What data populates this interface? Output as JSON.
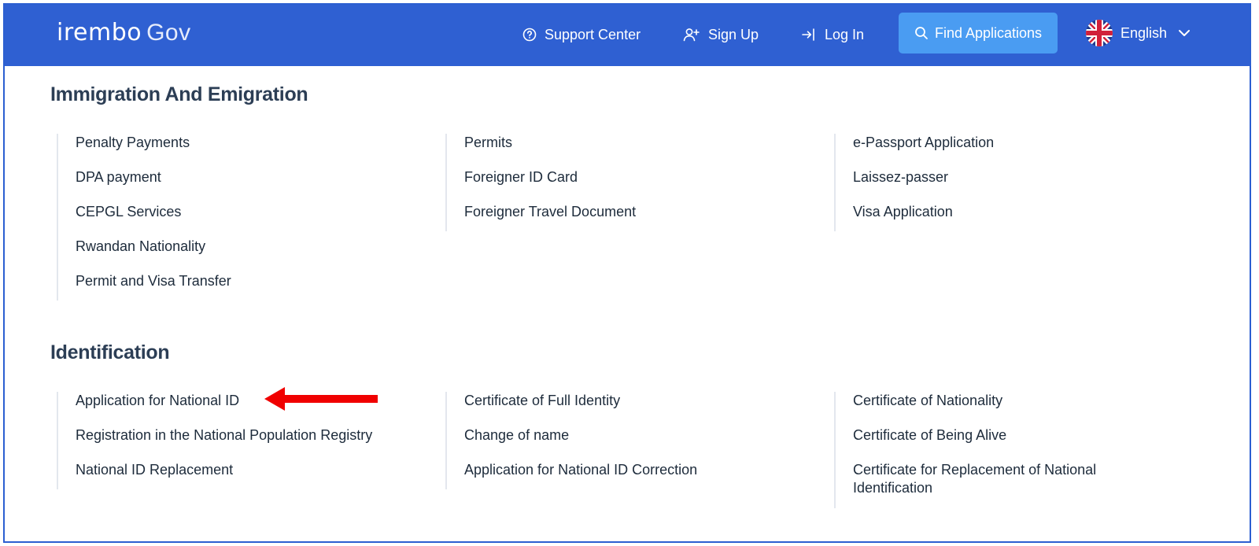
{
  "brand": {
    "name": "irembo",
    "suffix": "Gov"
  },
  "nav": {
    "support": "Support Center",
    "signup": "Sign Up",
    "login": "Log In",
    "find": "Find Applications",
    "language": "English"
  },
  "sections": [
    {
      "title": "Immigration And Emigration",
      "columns": [
        [
          "Penalty Payments",
          "DPA payment",
          "CEPGL Services",
          "Rwandan Nationality",
          "Permit and Visa Transfer"
        ],
        [
          "Permits",
          "Foreigner ID Card",
          "Foreigner Travel Document"
        ],
        [
          "e-Passport Application",
          "Laissez-passer",
          "Visa Application"
        ]
      ]
    },
    {
      "title": "Identification",
      "columns": [
        [
          "Application for National ID",
          "Registration in the National Population Registry",
          "National ID Replacement"
        ],
        [
          "Certificate of Full Identity",
          "Change of name",
          "Application for National ID Correction"
        ],
        [
          "Certificate of Nationality",
          "Certificate of Being Alive",
          "Certificate for Replacement of National Identification"
        ]
      ]
    }
  ],
  "colors": {
    "navbar": "#2f60d2",
    "find_button": "#4a9cf2",
    "annotation_arrow": "#f00000"
  },
  "icons": {
    "support": "question-circle-icon",
    "signup": "user-plus-icon",
    "login": "login-arrow-icon",
    "find": "search-icon",
    "language": "uk-flag-icon",
    "dropdown": "chevron-down-icon"
  }
}
